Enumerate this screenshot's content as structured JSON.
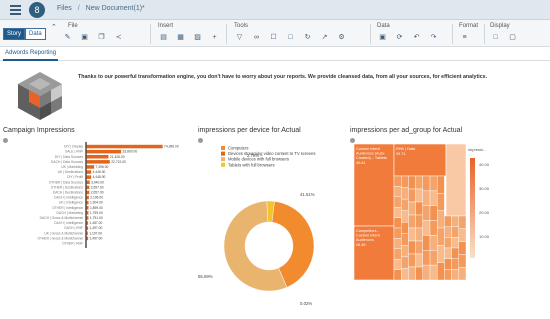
{
  "shell": {
    "avatar_initial": "8",
    "breadcrumb_root": "Files",
    "breadcrumb_sep": "/",
    "breadcrumb_doc": "New Document(1)*"
  },
  "toolbar": {
    "modes": [
      "Story",
      "Data"
    ],
    "groups": [
      {
        "label": "File"
      },
      {
        "label": "Insert"
      },
      {
        "label": "Tools"
      },
      {
        "label": "Data"
      },
      {
        "label": "Format"
      },
      {
        "label": "Display"
      }
    ]
  },
  "page_tab": "Adwords Reporting",
  "intro_text": "Thanks to our powerful transformation engine, you don't have to worry about your  reports. We provide cleansed data, from all your sources, for efficient analytics.",
  "colors": {
    "orange": "#f28a2e",
    "orange_dark": "#e1651b",
    "tan": "#e8b46e",
    "yellow": "#f4c430",
    "accent": "#1e5a8c"
  },
  "chart_data": [
    {
      "type": "bar",
      "title": "Campaign Impressions",
      "orientation": "horizontal",
      "categories": [
        "DIY | Display",
        "SALE | RHF",
        "DIY | Data Sources",
        "DACH | Data Sources",
        "UK | Marketing",
        "UK | Destinations",
        "DIY | Profit",
        "OTHER | Data Sources",
        "OTHER | Destinations",
        "DACH | Destinations",
        "DACH | Intelligence",
        "UK | Intelligence",
        "OTHER | Intelligence",
        "DACH | Marketing",
        "DACH | Gross & Multichannel",
        "DACH | Intelligence",
        "DACH | RHF",
        "UK | Gross & Multichannel",
        "OTHER | Gross & Multichannel",
        "OTHER | RHF"
      ],
      "values": [
        74396,
        33800,
        21426,
        22722,
        7396,
        4446,
        4448,
        3040,
        2657,
        2657,
        2196,
        1904,
        1899,
        1799,
        1791,
        1487,
        1497,
        1197,
        1497,
        0
      ],
      "value_labels": [
        "74,396.00",
        "33,800.00",
        "21,426.00",
        "22,722.00",
        "7,396.00",
        "4,446.00",
        "4,448.00",
        "3,040.00",
        "2,657.00",
        "2,657.00",
        "2,196.00",
        "1,904.00",
        "1,899.00",
        "1,799.00",
        "1,791.00",
        "1,487.00",
        "1,497.00",
        "1,197.00",
        "1,497.00",
        ""
      ]
    },
    {
      "type": "pie",
      "title": "impressions per device for Actual",
      "legend": [
        "Computers",
        "Devices streaming video content to TV screens",
        "Mobile devices with full browsers",
        "Tablets with full browsers"
      ],
      "legend_colors": [
        "#f28a2e",
        "#e1651b",
        "#e8b46e",
        "#f4c430"
      ],
      "slices": [
        {
          "name": "Computers",
          "value": 41.51,
          "label": "41.51%",
          "color": "#f28a2e"
        },
        {
          "name": "Devices streaming video content to TV screens",
          "value": 0.02,
          "label": "0.02%",
          "color": "#e1651b"
        },
        {
          "name": "Mobile devices with full browsers",
          "value": 55.69,
          "label": "55.69%",
          "color": "#e8b46e"
        },
        {
          "name": "Tablets with full browsers",
          "value": 2.78,
          "label": "2.78%",
          "color": "#f4c430"
        }
      ]
    },
    {
      "type": "heatmap",
      "title": "impressions per ad_group for Actual",
      "tiles": [
        {
          "label": "Custom Intent Audiences (Auto-Created) – Tablets",
          "value": 40.61,
          "value_label": "40.61"
        },
        {
          "label": "RHK | Data",
          "value": 29.71,
          "value_label": "29.71"
        },
        {
          "label": "Competitors - Custom Intent Audiences",
          "value": 26.45,
          "value_label": "26.45"
        }
      ],
      "legend_title": "impressi...",
      "legend_ticks": [
        "40.00",
        "30.00",
        "20.00",
        "10.00"
      ]
    }
  ]
}
